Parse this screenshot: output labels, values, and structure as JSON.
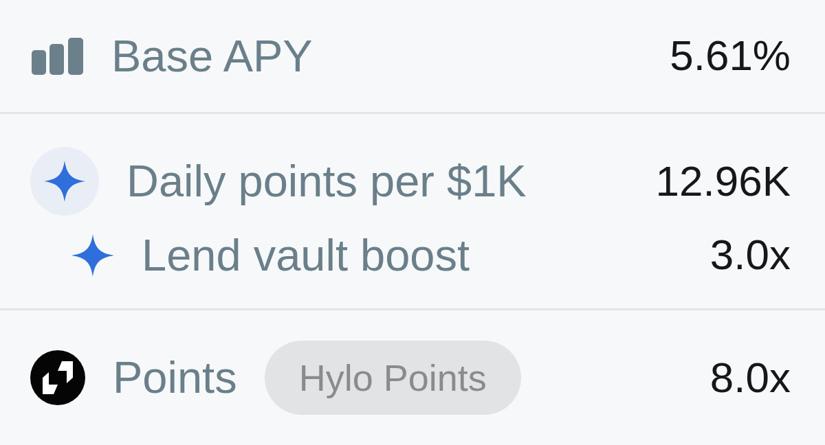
{
  "sections": [
    {
      "rows": [
        {
          "kind": "rate",
          "label": "Base APY",
          "value": "5.61%"
        }
      ]
    },
    {
      "rows": [
        {
          "kind": "points",
          "label": "Daily points per $1K",
          "value": "12.96K"
        },
        {
          "kind": "boost",
          "label": "Lend vault boost",
          "value": "3.0x"
        }
      ]
    },
    {
      "rows": [
        {
          "kind": "token",
          "label": "Points",
          "tag": "Hylo Points",
          "value": "8.0x"
        }
      ]
    }
  ]
}
